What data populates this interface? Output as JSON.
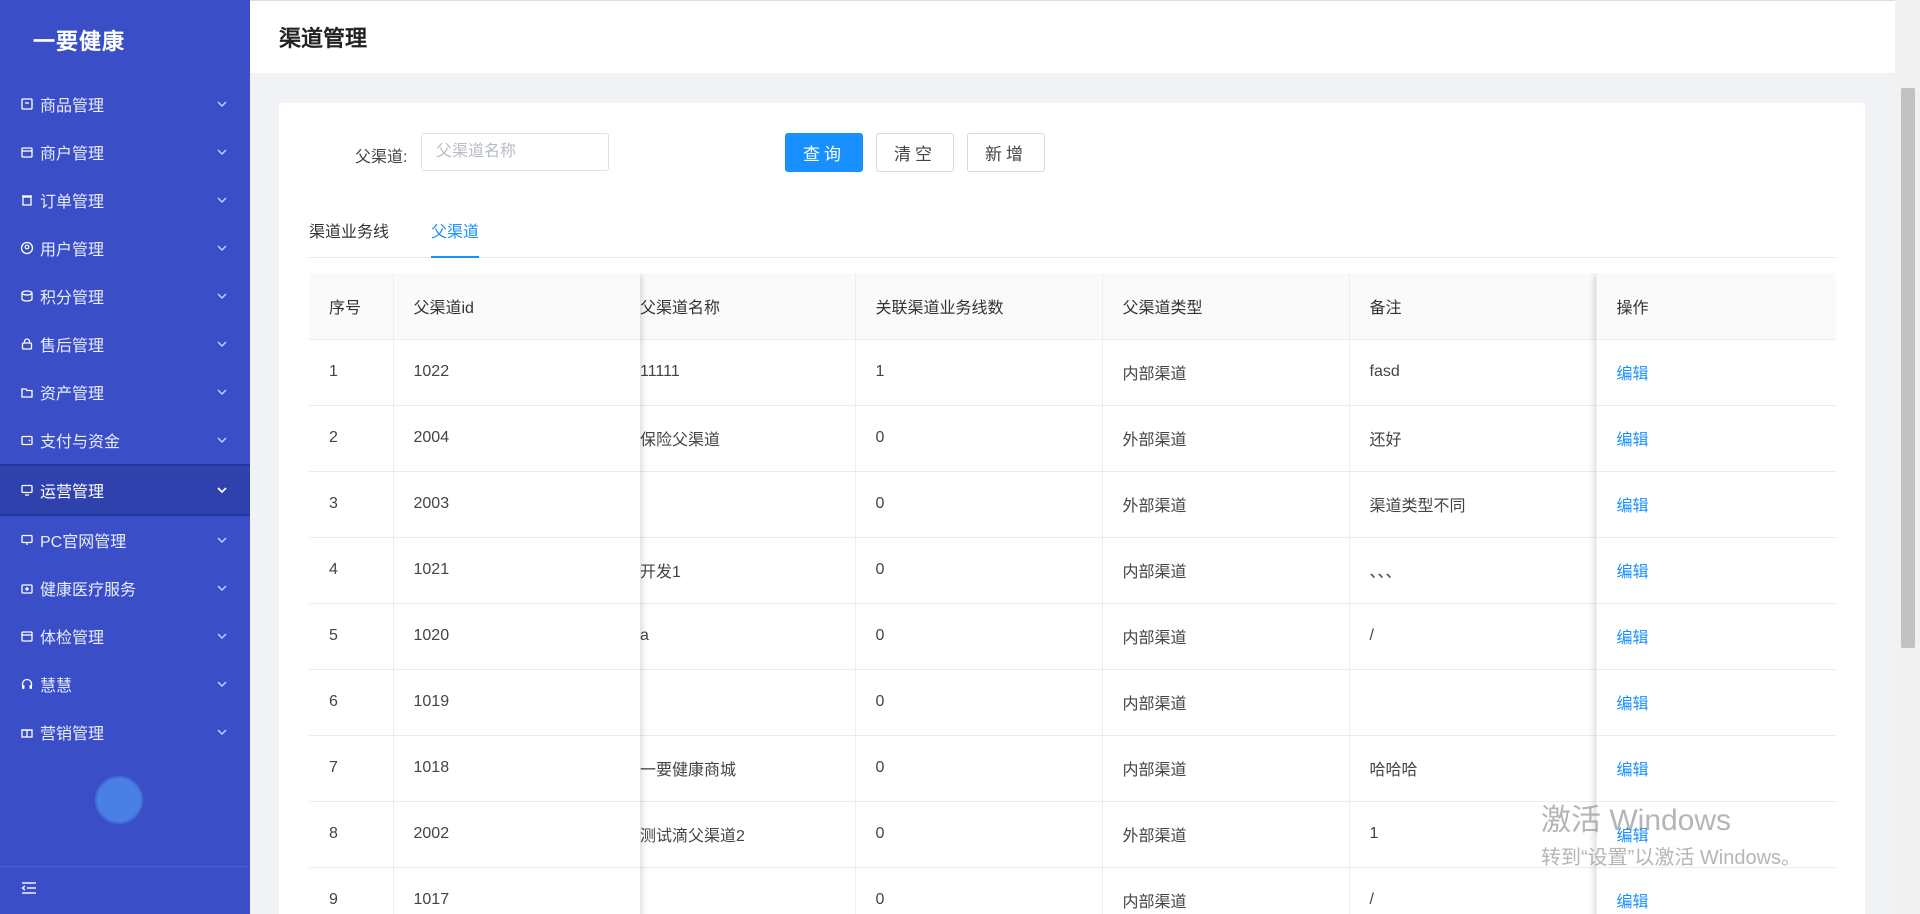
{
  "app": {
    "logo": "一要健康"
  },
  "sidebar": {
    "items": [
      {
        "label": "商品管理",
        "icon": "box-icon"
      },
      {
        "label": "商户管理",
        "icon": "store-icon"
      },
      {
        "label": "订单管理",
        "icon": "trash-icon"
      },
      {
        "label": "用户管理",
        "icon": "user-icon"
      },
      {
        "label": "积分管理",
        "icon": "coins-icon"
      },
      {
        "label": "售后管理",
        "icon": "lock-icon"
      },
      {
        "label": "资产管理",
        "icon": "folder-icon"
      },
      {
        "label": "支付与资金",
        "icon": "wallet-icon"
      },
      {
        "label": "运营管理",
        "icon": "monitor-icon",
        "active": true
      },
      {
        "label": "PC官网管理",
        "icon": "desktop-icon"
      },
      {
        "label": "健康医疗服务",
        "icon": "medkit-icon"
      },
      {
        "label": "体检管理",
        "icon": "calendar-icon"
      },
      {
        "label": "慧慧",
        "icon": "headset-icon"
      },
      {
        "label": "营销管理",
        "icon": "gift-icon"
      }
    ]
  },
  "header": {
    "title": "渠道管理"
  },
  "filter": {
    "label": "父渠道:",
    "placeholder": "父渠道名称",
    "value": "",
    "query_label": "查询",
    "clear_label": "清空",
    "add_label": "新增"
  },
  "tabs": [
    {
      "label": "渠道业务线",
      "active": false
    },
    {
      "label": "父渠道",
      "active": true
    }
  ],
  "table": {
    "columns": [
      "序号",
      "父渠道id",
      "父渠道名称",
      "关联渠道业务线数",
      "父渠道类型",
      "备注",
      "操作"
    ],
    "rows": [
      {
        "idx": "1",
        "pid": "1022",
        "name": "11111",
        "count": "1",
        "type": "内部渠道",
        "note": "fasd",
        "op": "编辑"
      },
      {
        "idx": "2",
        "pid": "2004",
        "name": "保险父渠道",
        "count": "0",
        "type": "外部渠道",
        "note": "还好",
        "op": "编辑"
      },
      {
        "idx": "3",
        "pid": "2003",
        "name": "",
        "count": "0",
        "type": "外部渠道",
        "note": "渠道类型不同",
        "op": "编辑"
      },
      {
        "idx": "4",
        "pid": "1021",
        "name": "开发1",
        "count": "0",
        "type": "内部渠道",
        "note": "、、、",
        "op": "编辑"
      },
      {
        "idx": "5",
        "pid": "1020",
        "name": "a",
        "count": "0",
        "type": "内部渠道",
        "note": "/",
        "op": "编辑"
      },
      {
        "idx": "6",
        "pid": "1019",
        "name": "",
        "count": "0",
        "type": "内部渠道",
        "note": "",
        "op": "编辑"
      },
      {
        "idx": "7",
        "pid": "1018",
        "name": "一要健康商城",
        "count": "0",
        "type": "内部渠道",
        "note": "哈哈哈",
        "op": "编辑"
      },
      {
        "idx": "8",
        "pid": "2002",
        "name": "测试滴父渠道2",
        "count": "0",
        "type": "外部渠道",
        "note": "1",
        "op": "编辑"
      },
      {
        "idx": "9",
        "pid": "1017",
        "name": "",
        "count": "0",
        "type": "内部渠道",
        "note": "/",
        "op": "编辑"
      }
    ]
  },
  "watermark": {
    "line1": "激活 Windows",
    "line2": "转到“设置”以激活 Windows。"
  },
  "colors": {
    "sidebar": "#3a4fc7",
    "primary": "#1890ff"
  }
}
